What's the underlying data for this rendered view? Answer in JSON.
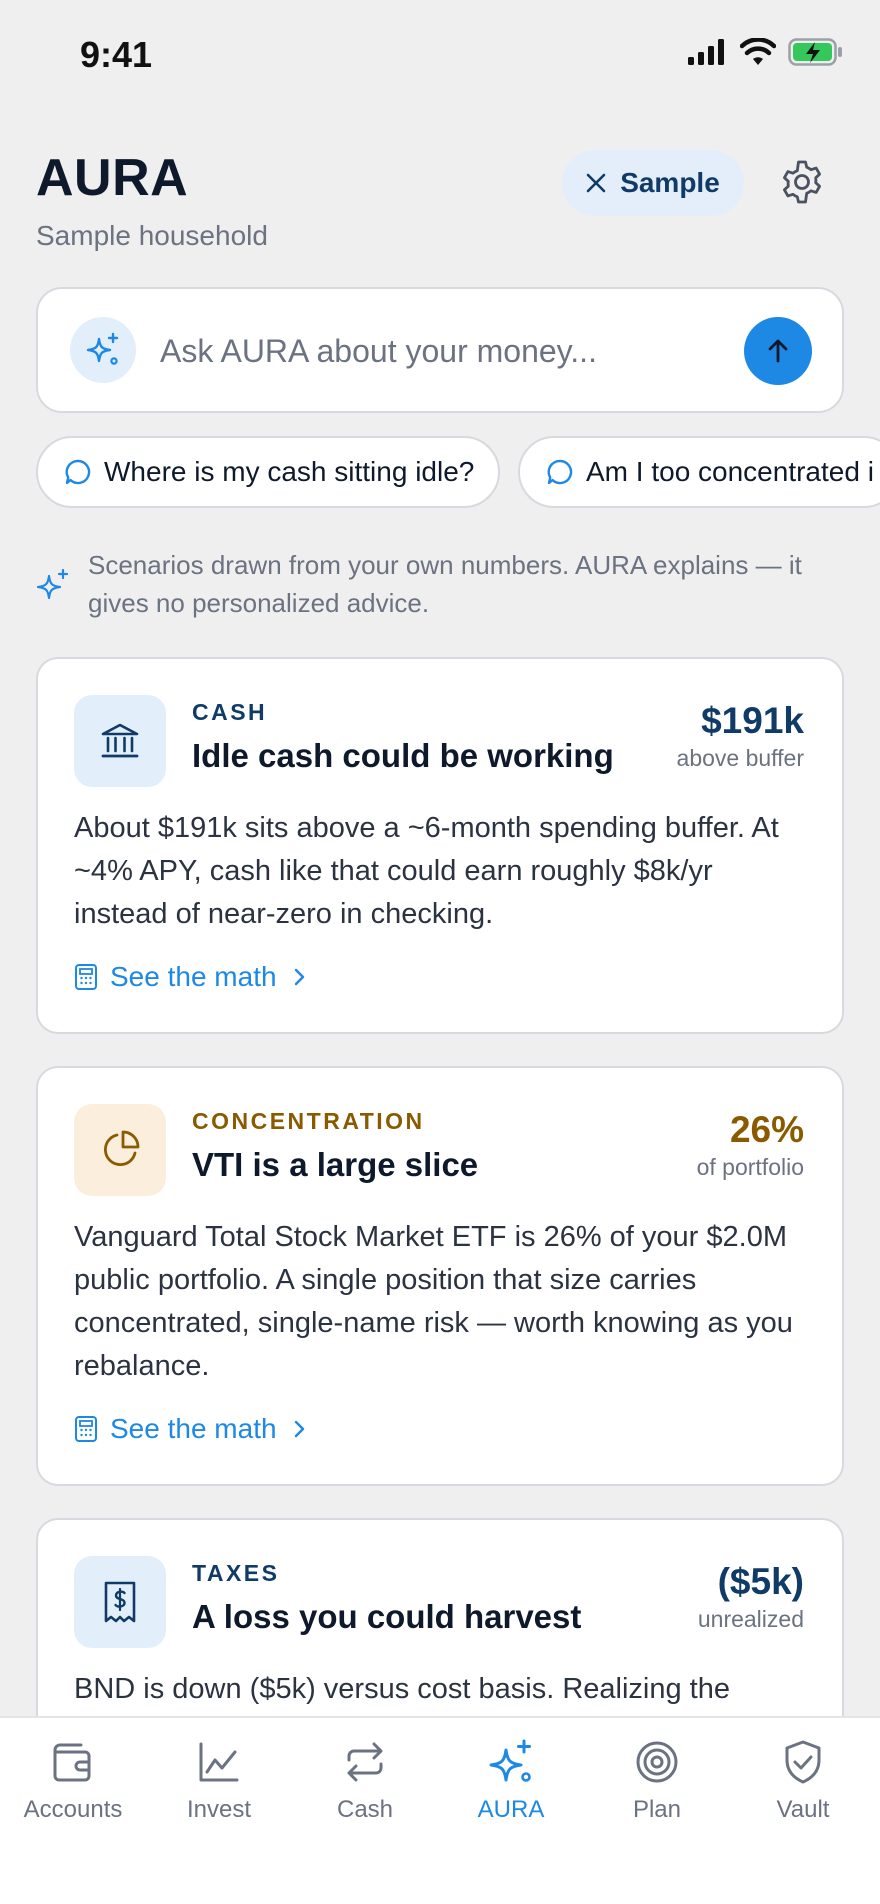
{
  "status_bar": {
    "time": "9:41"
  },
  "header": {
    "title": "AURA",
    "subtitle": "Sample household",
    "sample_label": "Sample"
  },
  "ask": {
    "placeholder": "Ask AURA about your money..."
  },
  "chips": [
    {
      "label": "Where is my cash sitting idle?"
    },
    {
      "label": "Am I too concentrated i"
    }
  ],
  "disclaimer": "Scenarios drawn from your own numbers. AURA explains — it gives no personalized advice.",
  "cards": [
    {
      "category": "CASH",
      "title": "Idle cash could be working",
      "metric_value": "$191k",
      "metric_caption": "above buffer",
      "body": "About $191k sits above a ~6-month spending buffer. At ~4% APY, cash like that could earn roughly $8k/yr instead of near-zero in checking.",
      "link": "See the math",
      "accent": "#0f3b66",
      "icon": "bank-icon"
    },
    {
      "category": "CONCENTRATION",
      "title": "VTI is a large slice",
      "metric_value": "26%",
      "metric_caption": "of portfolio",
      "body": "Vanguard Total Stock Market ETF is 26% of your $2.0M public portfolio. A single position that size carries concentrated, single-name risk — worth knowing as you rebalance.",
      "link": "See the math",
      "accent": "#8a5a00",
      "icon": "pie-chart-icon"
    },
    {
      "category": "TAXES",
      "title": "A loss you could harvest",
      "metric_value": "($5k)",
      "metric_caption": "unrealized",
      "body": "BND is down ($5k) versus cost basis. Realizing the",
      "accent": "#0f3b66",
      "icon": "receipt-icon"
    }
  ],
  "tabs": [
    {
      "label": "Accounts",
      "icon": "wallet-icon"
    },
    {
      "label": "Invest",
      "icon": "chart-icon"
    },
    {
      "label": "Cash",
      "icon": "transfer-icon"
    },
    {
      "label": "AURA",
      "icon": "sparkle-icon",
      "active": true
    },
    {
      "label": "Plan",
      "icon": "target-icon"
    },
    {
      "label": "Vault",
      "icon": "shield-icon"
    }
  ],
  "colors": {
    "accent": "#1e88e5",
    "navy": "#0f3b66",
    "amber": "#8a5a00",
    "background": "#efefef"
  }
}
